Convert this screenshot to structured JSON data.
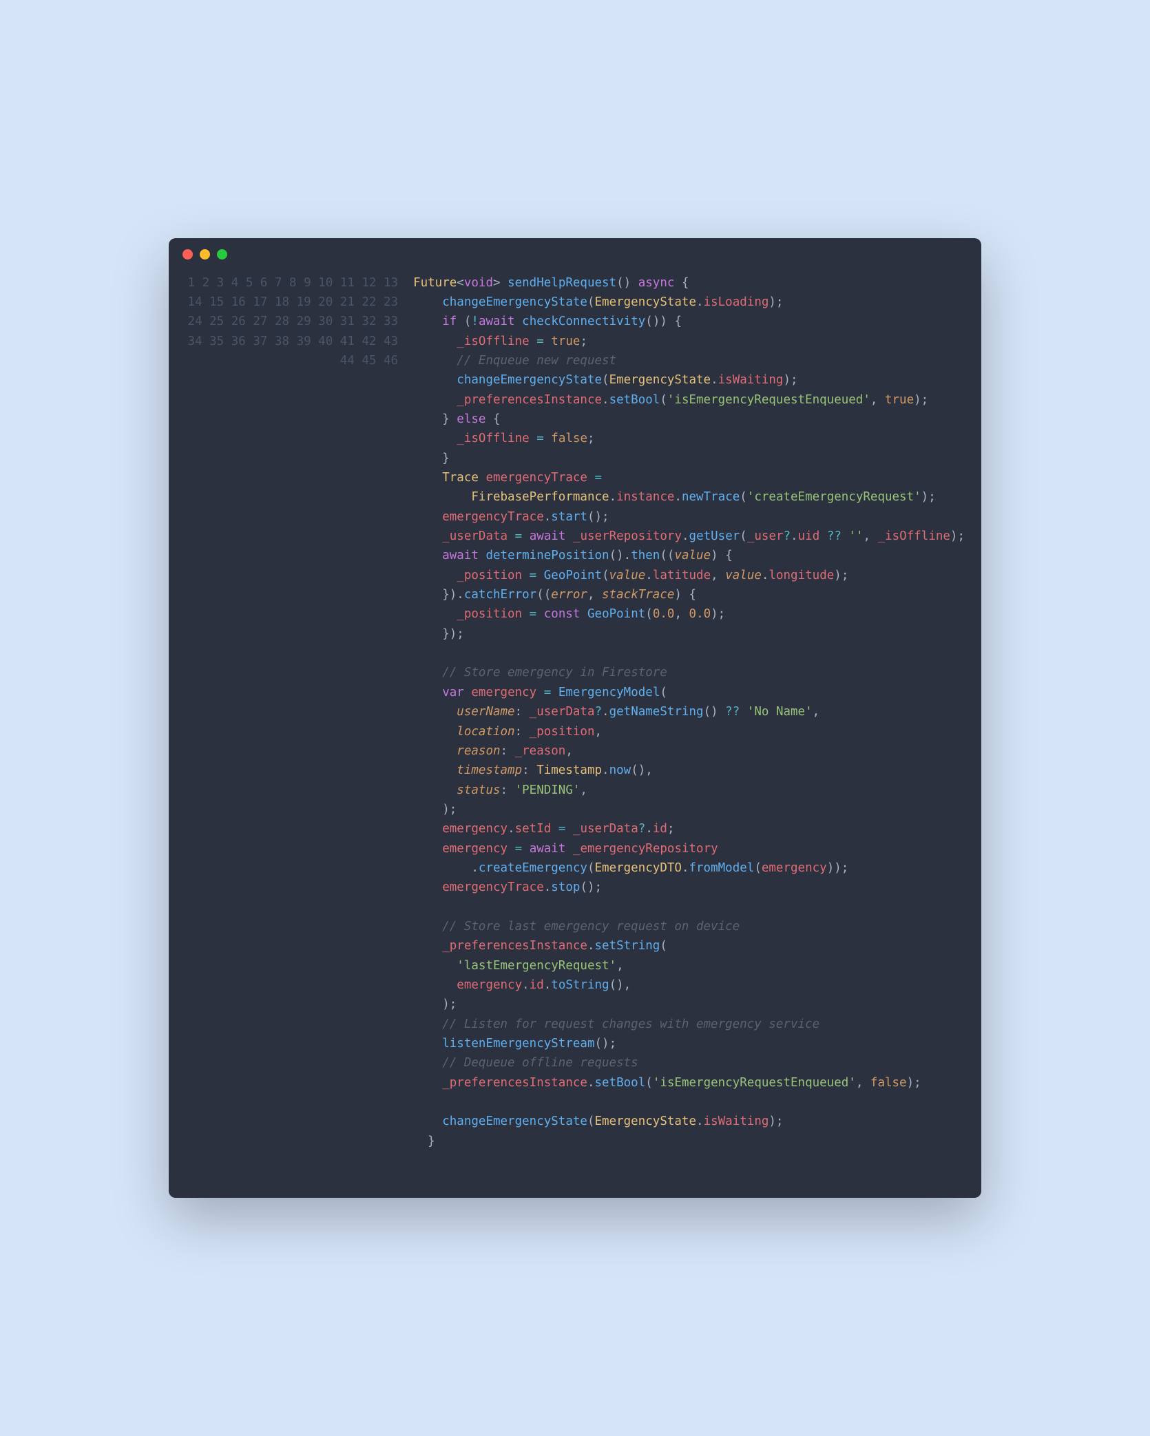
{
  "window": {
    "traffic_lights": {
      "close_color": "#ff5f56",
      "minimize_color": "#ffbd2e",
      "zoom_color": "#27c93f"
    }
  },
  "gutter": {
    "start": 1,
    "end": 46
  },
  "code": {
    "lines": [
      [
        [
          "tok-type",
          "Future"
        ],
        [
          "tok-punc",
          "<"
        ],
        [
          "tok-kw",
          "void"
        ],
        [
          "tok-punc",
          "> "
        ],
        [
          "tok-fn",
          "sendHelpRequest"
        ],
        [
          "tok-punc",
          "() "
        ],
        [
          "tok-kw",
          "async"
        ],
        [
          "tok-punc",
          " {"
        ]
      ],
      [
        [
          "tok-punc",
          "    "
        ],
        [
          "tok-fn",
          "changeEmergencyState"
        ],
        [
          "tok-punc",
          "("
        ],
        [
          "tok-type",
          "EmergencyState"
        ],
        [
          "tok-punc",
          "."
        ],
        [
          "tok-ident",
          "isLoading"
        ],
        [
          "tok-punc",
          ");"
        ]
      ],
      [
        [
          "tok-punc",
          "    "
        ],
        [
          "tok-kw",
          "if"
        ],
        [
          "tok-punc",
          " ("
        ],
        [
          "tok-op",
          "!"
        ],
        [
          "tok-kw",
          "await"
        ],
        [
          "tok-punc",
          " "
        ],
        [
          "tok-fn",
          "checkConnectivity"
        ],
        [
          "tok-punc",
          "()) {"
        ]
      ],
      [
        [
          "tok-punc",
          "      "
        ],
        [
          "tok-ident",
          "_isOffline"
        ],
        [
          "tok-punc",
          " "
        ],
        [
          "tok-op",
          "="
        ],
        [
          "tok-punc",
          " "
        ],
        [
          "tok-bool",
          "true"
        ],
        [
          "tok-punc",
          ";"
        ]
      ],
      [
        [
          "tok-punc",
          "      "
        ],
        [
          "tok-comment",
          "// Enqueue new request"
        ]
      ],
      [
        [
          "tok-punc",
          "      "
        ],
        [
          "tok-fn",
          "changeEmergencyState"
        ],
        [
          "tok-punc",
          "("
        ],
        [
          "tok-type",
          "EmergencyState"
        ],
        [
          "tok-punc",
          "."
        ],
        [
          "tok-ident",
          "isWaiting"
        ],
        [
          "tok-punc",
          ");"
        ]
      ],
      [
        [
          "tok-punc",
          "      "
        ],
        [
          "tok-ident",
          "_preferencesInstance"
        ],
        [
          "tok-punc",
          "."
        ],
        [
          "tok-fn",
          "setBool"
        ],
        [
          "tok-punc",
          "("
        ],
        [
          "tok-str",
          "'isEmergencyRequestEnqueued'"
        ],
        [
          "tok-punc",
          ", "
        ],
        [
          "tok-bool",
          "true"
        ],
        [
          "tok-punc",
          ");"
        ]
      ],
      [
        [
          "tok-punc",
          "    } "
        ],
        [
          "tok-kw",
          "else"
        ],
        [
          "tok-punc",
          " {"
        ]
      ],
      [
        [
          "tok-punc",
          "      "
        ],
        [
          "tok-ident",
          "_isOffline"
        ],
        [
          "tok-punc",
          " "
        ],
        [
          "tok-op",
          "="
        ],
        [
          "tok-punc",
          " "
        ],
        [
          "tok-bool",
          "false"
        ],
        [
          "tok-punc",
          ";"
        ]
      ],
      [
        [
          "tok-punc",
          "    }"
        ]
      ],
      [
        [
          "tok-punc",
          "    "
        ],
        [
          "tok-type",
          "Trace"
        ],
        [
          "tok-punc",
          " "
        ],
        [
          "tok-ident",
          "emergencyTrace"
        ],
        [
          "tok-punc",
          " "
        ],
        [
          "tok-op",
          "="
        ]
      ],
      [
        [
          "tok-punc",
          "        "
        ],
        [
          "tok-type",
          "FirebasePerformance"
        ],
        [
          "tok-punc",
          "."
        ],
        [
          "tok-ident",
          "instance"
        ],
        [
          "tok-punc",
          "."
        ],
        [
          "tok-fn",
          "newTrace"
        ],
        [
          "tok-punc",
          "("
        ],
        [
          "tok-str",
          "'createEmergencyRequest'"
        ],
        [
          "tok-punc",
          ");"
        ]
      ],
      [
        [
          "tok-punc",
          "    "
        ],
        [
          "tok-ident",
          "emergencyTrace"
        ],
        [
          "tok-punc",
          "."
        ],
        [
          "tok-fn",
          "start"
        ],
        [
          "tok-punc",
          "();"
        ]
      ],
      [
        [
          "tok-punc",
          "    "
        ],
        [
          "tok-ident",
          "_userData"
        ],
        [
          "tok-punc",
          " "
        ],
        [
          "tok-op",
          "="
        ],
        [
          "tok-punc",
          " "
        ],
        [
          "tok-kw",
          "await"
        ],
        [
          "tok-punc",
          " "
        ],
        [
          "tok-ident",
          "_userRepository"
        ],
        [
          "tok-punc",
          "."
        ],
        [
          "tok-fn",
          "getUser"
        ],
        [
          "tok-punc",
          "("
        ],
        [
          "tok-ident",
          "_user"
        ],
        [
          "tok-op",
          "?"
        ],
        [
          "tok-punc",
          "."
        ],
        [
          "tok-ident",
          "uid"
        ],
        [
          "tok-punc",
          " "
        ],
        [
          "tok-op",
          "??"
        ],
        [
          "tok-punc",
          " "
        ],
        [
          "tok-str",
          "''"
        ],
        [
          "tok-punc",
          ", "
        ],
        [
          "tok-ident",
          "_isOffline"
        ],
        [
          "tok-punc",
          ");"
        ]
      ],
      [
        [
          "tok-punc",
          "    "
        ],
        [
          "tok-kw",
          "await"
        ],
        [
          "tok-punc",
          " "
        ],
        [
          "tok-fn",
          "determinePosition"
        ],
        [
          "tok-punc",
          "()."
        ],
        [
          "tok-fn",
          "then"
        ],
        [
          "tok-punc",
          "(("
        ],
        [
          "tok-param",
          "value"
        ],
        [
          "tok-punc",
          ") {"
        ]
      ],
      [
        [
          "tok-punc",
          "      "
        ],
        [
          "tok-ident",
          "_position"
        ],
        [
          "tok-punc",
          " "
        ],
        [
          "tok-op",
          "="
        ],
        [
          "tok-punc",
          " "
        ],
        [
          "tok-fn",
          "GeoPoint"
        ],
        [
          "tok-punc",
          "("
        ],
        [
          "tok-param",
          "value"
        ],
        [
          "tok-punc",
          "."
        ],
        [
          "tok-ident",
          "latitude"
        ],
        [
          "tok-punc",
          ", "
        ],
        [
          "tok-param",
          "value"
        ],
        [
          "tok-punc",
          "."
        ],
        [
          "tok-ident",
          "longitude"
        ],
        [
          "tok-punc",
          ");"
        ]
      ],
      [
        [
          "tok-punc",
          "    })."
        ],
        [
          "tok-fn",
          "catchError"
        ],
        [
          "tok-punc",
          "(("
        ],
        [
          "tok-param",
          "error"
        ],
        [
          "tok-punc",
          ", "
        ],
        [
          "tok-param",
          "stackTrace"
        ],
        [
          "tok-punc",
          ") {"
        ]
      ],
      [
        [
          "tok-punc",
          "      "
        ],
        [
          "tok-ident",
          "_position"
        ],
        [
          "tok-punc",
          " "
        ],
        [
          "tok-op",
          "="
        ],
        [
          "tok-punc",
          " "
        ],
        [
          "tok-kw",
          "const"
        ],
        [
          "tok-punc",
          " "
        ],
        [
          "tok-fn",
          "GeoPoint"
        ],
        [
          "tok-punc",
          "("
        ],
        [
          "tok-num",
          "0.0"
        ],
        [
          "tok-punc",
          ", "
        ],
        [
          "tok-num",
          "0.0"
        ],
        [
          "tok-punc",
          ");"
        ]
      ],
      [
        [
          "tok-punc",
          "    });"
        ]
      ],
      [
        [
          "tok-punc",
          ""
        ]
      ],
      [
        [
          "tok-punc",
          "    "
        ],
        [
          "tok-comment",
          "// Store emergency in Firestore"
        ]
      ],
      [
        [
          "tok-punc",
          "    "
        ],
        [
          "tok-kw",
          "var"
        ],
        [
          "tok-punc",
          " "
        ],
        [
          "tok-ident",
          "emergency"
        ],
        [
          "tok-punc",
          " "
        ],
        [
          "tok-op",
          "="
        ],
        [
          "tok-punc",
          " "
        ],
        [
          "tok-fn",
          "EmergencyModel"
        ],
        [
          "tok-punc",
          "("
        ]
      ],
      [
        [
          "tok-punc",
          "      "
        ],
        [
          "tok-labelit",
          "userName"
        ],
        [
          "tok-punc",
          ": "
        ],
        [
          "tok-ident",
          "_userData"
        ],
        [
          "tok-op",
          "?"
        ],
        [
          "tok-punc",
          "."
        ],
        [
          "tok-fn",
          "getNameString"
        ],
        [
          "tok-punc",
          "() "
        ],
        [
          "tok-op",
          "??"
        ],
        [
          "tok-punc",
          " "
        ],
        [
          "tok-str",
          "'No Name'"
        ],
        [
          "tok-punc",
          ","
        ]
      ],
      [
        [
          "tok-punc",
          "      "
        ],
        [
          "tok-labelit",
          "location"
        ],
        [
          "tok-punc",
          ": "
        ],
        [
          "tok-ident",
          "_position"
        ],
        [
          "tok-punc",
          ","
        ]
      ],
      [
        [
          "tok-punc",
          "      "
        ],
        [
          "tok-labelit",
          "reason"
        ],
        [
          "tok-punc",
          ": "
        ],
        [
          "tok-ident",
          "_reason"
        ],
        [
          "tok-punc",
          ","
        ]
      ],
      [
        [
          "tok-punc",
          "      "
        ],
        [
          "tok-labelit",
          "timestamp"
        ],
        [
          "tok-punc",
          ": "
        ],
        [
          "tok-type",
          "Timestamp"
        ],
        [
          "tok-punc",
          "."
        ],
        [
          "tok-fn",
          "now"
        ],
        [
          "tok-punc",
          "(),"
        ]
      ],
      [
        [
          "tok-punc",
          "      "
        ],
        [
          "tok-labelit",
          "status"
        ],
        [
          "tok-punc",
          ": "
        ],
        [
          "tok-str",
          "'PENDING'"
        ],
        [
          "tok-punc",
          ","
        ]
      ],
      [
        [
          "tok-punc",
          "    );"
        ]
      ],
      [
        [
          "tok-punc",
          "    "
        ],
        [
          "tok-ident",
          "emergency"
        ],
        [
          "tok-punc",
          "."
        ],
        [
          "tok-ident",
          "setId"
        ],
        [
          "tok-punc",
          " "
        ],
        [
          "tok-op",
          "="
        ],
        [
          "tok-punc",
          " "
        ],
        [
          "tok-ident",
          "_userData"
        ],
        [
          "tok-op",
          "?"
        ],
        [
          "tok-punc",
          "."
        ],
        [
          "tok-ident",
          "id"
        ],
        [
          "tok-punc",
          ";"
        ]
      ],
      [
        [
          "tok-punc",
          "    "
        ],
        [
          "tok-ident",
          "emergency"
        ],
        [
          "tok-punc",
          " "
        ],
        [
          "tok-op",
          "="
        ],
        [
          "tok-punc",
          " "
        ],
        [
          "tok-kw",
          "await"
        ],
        [
          "tok-punc",
          " "
        ],
        [
          "tok-ident",
          "_emergencyRepository"
        ]
      ],
      [
        [
          "tok-punc",
          "        ."
        ],
        [
          "tok-fn",
          "createEmergency"
        ],
        [
          "tok-punc",
          "("
        ],
        [
          "tok-type",
          "EmergencyDTO"
        ],
        [
          "tok-punc",
          "."
        ],
        [
          "tok-fn",
          "fromModel"
        ],
        [
          "tok-punc",
          "("
        ],
        [
          "tok-ident",
          "emergency"
        ],
        [
          "tok-punc",
          "));"
        ]
      ],
      [
        [
          "tok-punc",
          "    "
        ],
        [
          "tok-ident",
          "emergencyTrace"
        ],
        [
          "tok-punc",
          "."
        ],
        [
          "tok-fn",
          "stop"
        ],
        [
          "tok-punc",
          "();"
        ]
      ],
      [
        [
          "tok-punc",
          ""
        ]
      ],
      [
        [
          "tok-punc",
          "    "
        ],
        [
          "tok-comment",
          "// Store last emergency request on device"
        ]
      ],
      [
        [
          "tok-punc",
          "    "
        ],
        [
          "tok-ident",
          "_preferencesInstance"
        ],
        [
          "tok-punc",
          "."
        ],
        [
          "tok-fn",
          "setString"
        ],
        [
          "tok-punc",
          "("
        ]
      ],
      [
        [
          "tok-punc",
          "      "
        ],
        [
          "tok-str",
          "'lastEmergencyRequest'"
        ],
        [
          "tok-punc",
          ","
        ]
      ],
      [
        [
          "tok-punc",
          "      "
        ],
        [
          "tok-ident",
          "emergency"
        ],
        [
          "tok-punc",
          "."
        ],
        [
          "tok-ident",
          "id"
        ],
        [
          "tok-punc",
          "."
        ],
        [
          "tok-fn",
          "toString"
        ],
        [
          "tok-punc",
          "(),"
        ]
      ],
      [
        [
          "tok-punc",
          "    );"
        ]
      ],
      [
        [
          "tok-punc",
          "    "
        ],
        [
          "tok-comment",
          "// Listen for request changes with emergency service"
        ]
      ],
      [
        [
          "tok-punc",
          "    "
        ],
        [
          "tok-fn",
          "listenEmergencyStream"
        ],
        [
          "tok-punc",
          "();"
        ]
      ],
      [
        [
          "tok-punc",
          "    "
        ],
        [
          "tok-comment",
          "// Dequeue offline requests"
        ]
      ],
      [
        [
          "tok-punc",
          "    "
        ],
        [
          "tok-ident",
          "_preferencesInstance"
        ],
        [
          "tok-punc",
          "."
        ],
        [
          "tok-fn",
          "setBool"
        ],
        [
          "tok-punc",
          "("
        ],
        [
          "tok-str",
          "'isEmergencyRequestEnqueued'"
        ],
        [
          "tok-punc",
          ", "
        ],
        [
          "tok-bool",
          "false"
        ],
        [
          "tok-punc",
          ");"
        ]
      ],
      [
        [
          "tok-punc",
          ""
        ]
      ],
      [
        [
          "tok-punc",
          "    "
        ],
        [
          "tok-fn",
          "changeEmergencyState"
        ],
        [
          "tok-punc",
          "("
        ],
        [
          "tok-type",
          "EmergencyState"
        ],
        [
          "tok-punc",
          "."
        ],
        [
          "tok-ident",
          "isWaiting"
        ],
        [
          "tok-punc",
          ");"
        ]
      ],
      [
        [
          "tok-punc",
          "  }"
        ]
      ],
      [
        [
          "tok-punc",
          ""
        ]
      ]
    ]
  }
}
